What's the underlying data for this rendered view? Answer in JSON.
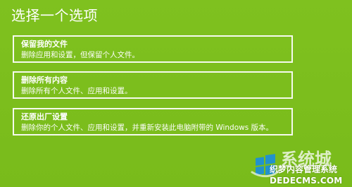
{
  "header": {
    "title": "选择一个选项"
  },
  "options": [
    {
      "title": "保留我的文件",
      "description": "删除应用和设置，但保留个人文件。"
    },
    {
      "title": "删除所有内容",
      "description": "删除所有个人文件、应用和设置。"
    },
    {
      "title": "还原出厂设置",
      "description": "删除你的个人文件、应用和设置，并重新安装此电脑附带的 Windows 版本。"
    }
  ],
  "watermark": {
    "brand_cn": "系统城",
    "line1": "织梦内容管理系统",
    "line2": "DEDECMS.COM",
    "logo_icon": "windows-logo-icon"
  },
  "colors": {
    "background": "#7dbf1e",
    "text": "#ffffff",
    "option_border": "#ffffff"
  }
}
